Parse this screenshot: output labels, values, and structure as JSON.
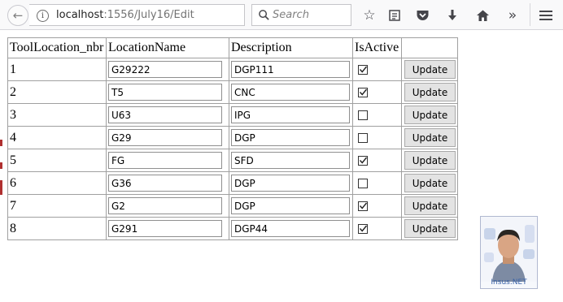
{
  "browser": {
    "url_host": "localhost",
    "url_path": ":1556/July16/Edit",
    "search_placeholder": "Search"
  },
  "table": {
    "headers": [
      "ToolLocation_nbr",
      "LocationName",
      "Description",
      "IsActive",
      ""
    ],
    "rows": [
      {
        "nbr": "1",
        "name": "G29222",
        "desc": "DGP111",
        "active": true
      },
      {
        "nbr": "2",
        "name": "T5",
        "desc": "CNC",
        "active": true
      },
      {
        "nbr": "3",
        "name": "U63",
        "desc": "IPG",
        "active": false
      },
      {
        "nbr": "4",
        "name": "G29",
        "desc": "DGP",
        "active": false
      },
      {
        "nbr": "5",
        "name": "FG",
        "desc": "SFD",
        "active": true
      },
      {
        "nbr": "6",
        "name": "G36",
        "desc": "DGP",
        "active": false
      },
      {
        "nbr": "7",
        "name": "G2",
        "desc": "DGP",
        "active": true
      },
      {
        "nbr": "8",
        "name": "G291",
        "desc": "DGP44",
        "active": true
      }
    ],
    "update_label": "Update"
  },
  "watermark": {
    "label": "Insus.NET"
  },
  "colors": {
    "toolbar_bg": "#f9f9fa",
    "button_bg": "#e3e3e3",
    "border": "#a0a0a0"
  },
  "icons": [
    "back-arrow-icon",
    "info-icon",
    "reload-icon",
    "search-icon",
    "bookmark-star-icon",
    "reading-list-icon",
    "pocket-icon",
    "download-icon",
    "home-icon",
    "overflow-chevrons-icon",
    "hamburger-menu-icon"
  ]
}
